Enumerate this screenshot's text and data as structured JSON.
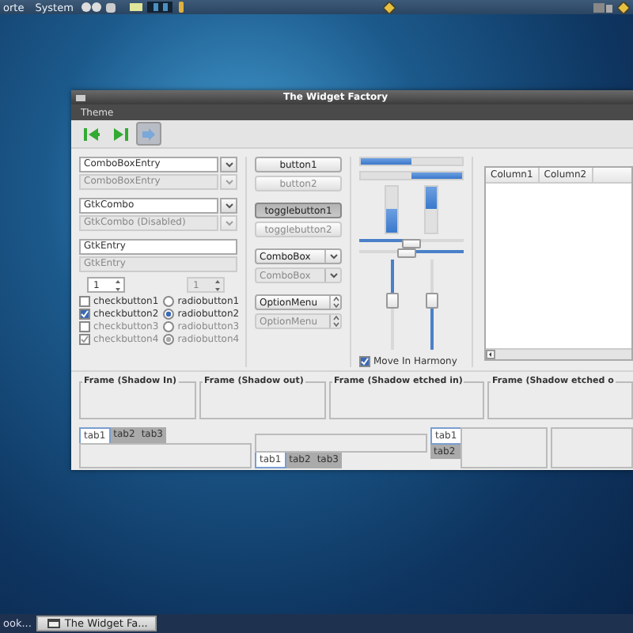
{
  "top_panel": {
    "menus": [
      "orte",
      "System"
    ]
  },
  "window": {
    "title": "The Widget Factory",
    "menu": [
      "Theme"
    ],
    "toolbar": [
      {
        "kind": "first",
        "pressed": false
      },
      {
        "kind": "last",
        "pressed": false
      },
      {
        "kind": "jump",
        "pressed": true
      }
    ],
    "combo_entries": [
      {
        "text": "ComboBoxEntry",
        "disabled": false
      },
      {
        "text": "ComboBoxEntry",
        "disabled": true
      }
    ],
    "combos": [
      {
        "text": "GtkCombo",
        "disabled": false
      },
      {
        "text": "GtkCombo (Disabled)",
        "disabled": true
      }
    ],
    "entries": [
      {
        "value": "GtkEntry",
        "disabled": false
      },
      {
        "value": "GtkEntry",
        "disabled": true
      }
    ],
    "spins": [
      {
        "value": "1",
        "disabled": false
      },
      {
        "value": "1",
        "disabled": true
      }
    ],
    "checks": [
      {
        "label": "checkbutton1",
        "checked": false,
        "disabled": false
      },
      {
        "label": "checkbutton2",
        "checked": true,
        "disabled": false
      },
      {
        "label": "checkbutton3",
        "checked": false,
        "disabled": true
      },
      {
        "label": "checkbutton4",
        "checked": true,
        "disabled": true
      }
    ],
    "radios": [
      {
        "label": "radiobutton1",
        "selected": false,
        "disabled": false
      },
      {
        "label": "radiobutton2",
        "selected": true,
        "disabled": false
      },
      {
        "label": "radiobutton3",
        "selected": false,
        "disabled": true
      },
      {
        "label": "radiobutton4",
        "selected": true,
        "disabled": true
      }
    ],
    "buttons": [
      {
        "kind": "button",
        "label": "button1",
        "disabled": false,
        "active": false
      },
      {
        "kind": "button",
        "label": "button2",
        "disabled": true,
        "active": false
      },
      {
        "kind": "toggle",
        "label": "togglebutton1",
        "disabled": false,
        "active": true
      },
      {
        "kind": "toggle",
        "label": "togglebutton2",
        "disabled": true,
        "active": false
      },
      {
        "kind": "combo",
        "label": "ComboBox",
        "disabled": false,
        "active": false
      },
      {
        "kind": "combo",
        "label": "ComboBox",
        "disabled": true,
        "active": false
      },
      {
        "kind": "option",
        "label": "OptionMenu",
        "disabled": false,
        "active": false
      },
      {
        "kind": "option",
        "label": "OptionMenu",
        "disabled": true,
        "active": false
      }
    ],
    "progress_bars": [
      {
        "kind": "horizontal",
        "level": 0.5,
        "inverted": false
      },
      {
        "kind": "horizontal",
        "level": 0.5,
        "inverted": true
      },
      {
        "kind": "vertical",
        "level": 0.5,
        "inverted": true
      },
      {
        "kind": "vertical",
        "level": 0.5,
        "inverted": false
      }
    ],
    "scales": [
      {
        "kind": "horizontal",
        "level": 0.5,
        "inverted": false
      },
      {
        "kind": "horizontal",
        "level": 0.55,
        "inverted": true
      },
      {
        "kind": "vertical",
        "level": 0.45,
        "inverted": false
      },
      {
        "kind": "vertical",
        "level": 0.55,
        "inverted": true
      }
    ],
    "harmony": {
      "label": "Move In Harmony",
      "checked": true
    },
    "tree": {
      "columns": [
        "Column1",
        "Column2"
      ]
    },
    "frames": [
      "Frame (Shadow In)",
      "Frame (Shadow out)",
      "Frame (Shadow etched in)",
      "Frame (Shadow etched o"
    ],
    "notebooks": [
      {
        "kind": "top",
        "tabs": [
          {
            "label": "tab1",
            "selected": true
          },
          {
            "label": "tab2",
            "selected": false
          },
          {
            "label": "tab3",
            "selected": false
          }
        ]
      },
      {
        "kind": "bottom",
        "tabs": [
          {
            "label": "tab1",
            "selected": true
          },
          {
            "label": "tab2",
            "selected": false
          },
          {
            "label": "tab3",
            "selected": false
          }
        ]
      },
      {
        "kind": "left",
        "tabs": [
          {
            "label": "tab1",
            "selected": true
          },
          {
            "label": "tab2",
            "selected": false
          }
        ]
      },
      {
        "kind": "right"
      }
    ]
  },
  "taskbar": [
    {
      "label": "ook...",
      "selected": false
    },
    {
      "label": "The Widget Fa...",
      "selected": true
    }
  ]
}
